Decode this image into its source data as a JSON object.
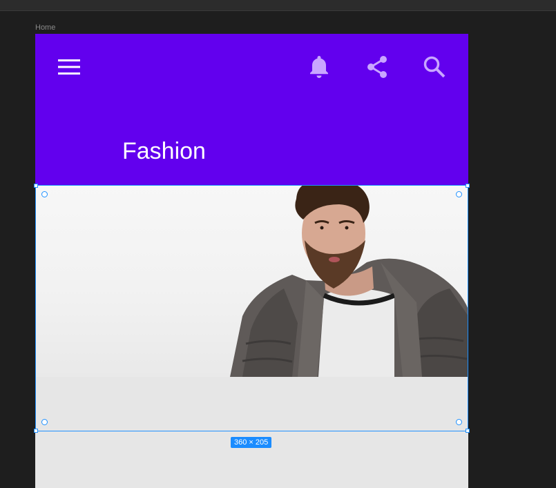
{
  "canvas": {
    "frame_label": "Home",
    "selection_size": "360 × 205"
  },
  "appbar": {
    "title": "Fashion",
    "background": "#6200ee",
    "icons": [
      "menu-icon",
      "bell-icon",
      "share-icon",
      "search-icon"
    ]
  },
  "hero": {
    "image_subject": "man with beard in grey puffer jacket"
  },
  "colors": {
    "selection": "#1e90ff",
    "canvas_bg": "#1e1e1e"
  }
}
